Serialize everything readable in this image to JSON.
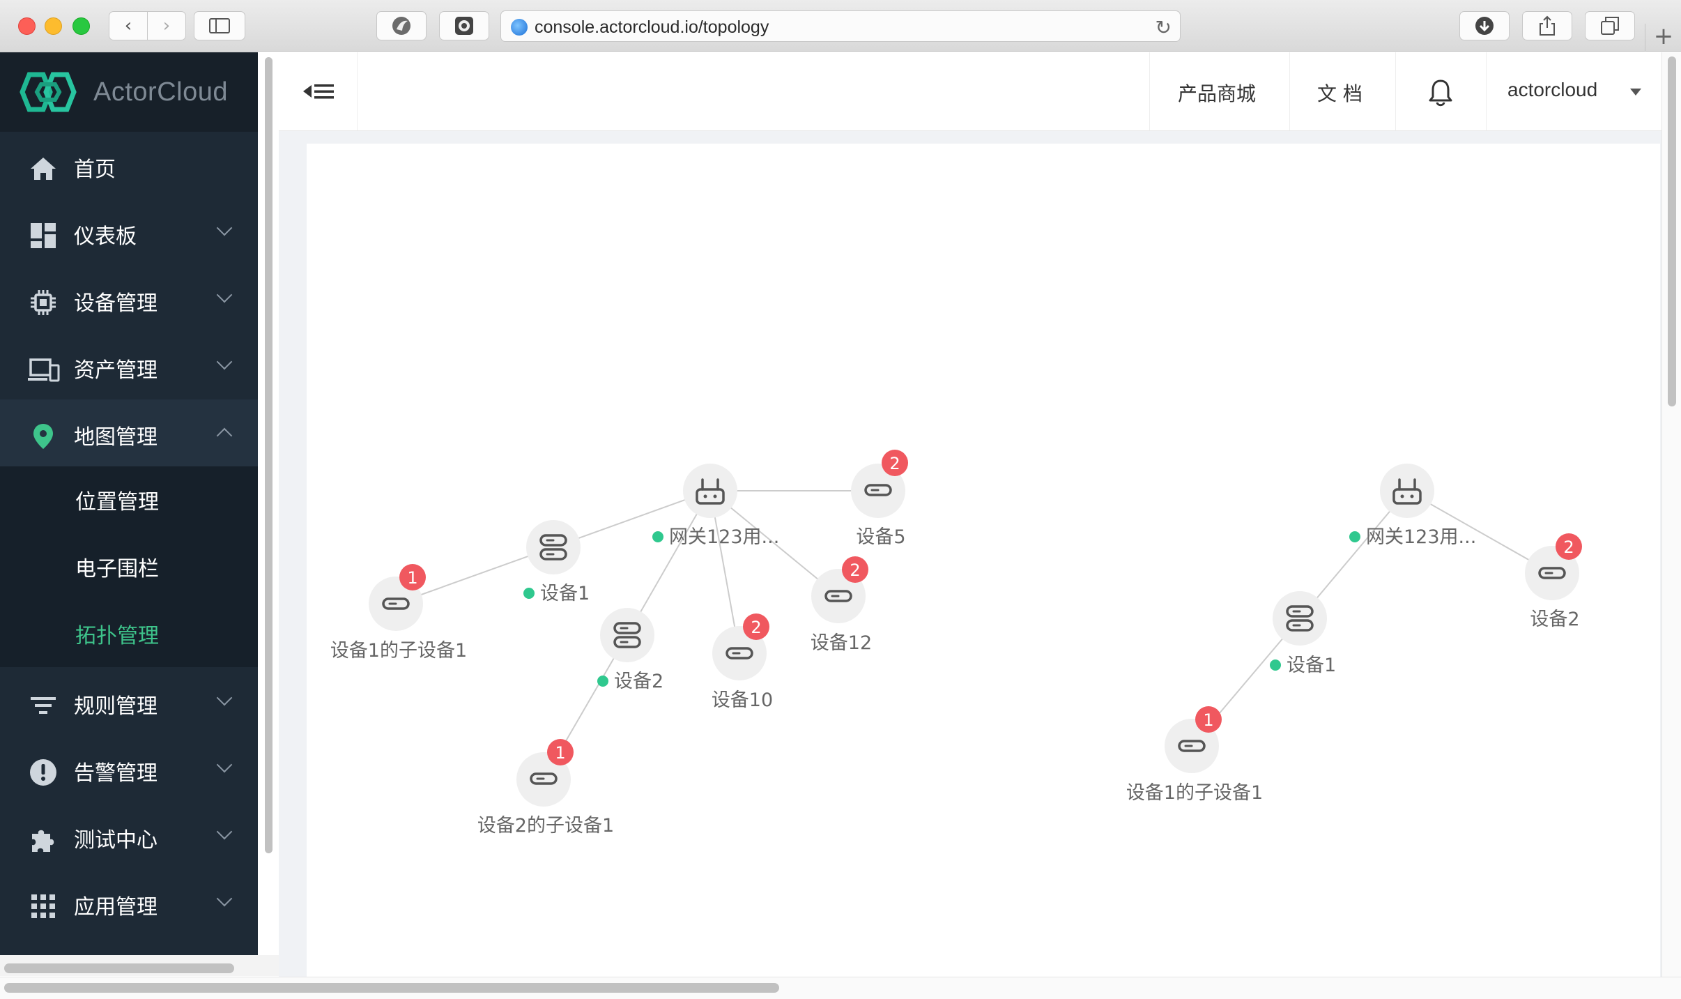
{
  "browser": {
    "url": "console.actorcloud.io/topology"
  },
  "app": {
    "logo_text": "ActorCloud"
  },
  "sidebar": {
    "items": [
      {
        "label": "首页",
        "icon": "home-icon"
      },
      {
        "label": "仪表板",
        "icon": "dashboard-icon"
      },
      {
        "label": "设备管理",
        "icon": "chip-icon"
      },
      {
        "label": "资产管理",
        "icon": "devices-icon"
      },
      {
        "label": "地图管理",
        "icon": "location-pin-icon",
        "expanded": true
      },
      {
        "label": "规则管理",
        "icon": "filter-icon"
      },
      {
        "label": "告警管理",
        "icon": "alert-icon"
      },
      {
        "label": "测试中心",
        "icon": "puzzle-icon"
      },
      {
        "label": "应用管理",
        "icon": "apps-grid-icon"
      }
    ],
    "map_submenu": [
      {
        "label": "位置管理"
      },
      {
        "label": "电子围栏"
      },
      {
        "label": "拓扑管理",
        "active": true
      }
    ],
    "accent_color": "#3ec48b"
  },
  "header": {
    "store": "产品商城",
    "docs": "文 档",
    "user": "actorcloud"
  },
  "topology": {
    "status_online_color": "#2fc88e",
    "badge_color": "#f0585f",
    "graph1": {
      "nodes": [
        {
          "id": "g1",
          "type": "gateway",
          "label": "网关123用...",
          "online": true
        },
        {
          "id": "d5",
          "type": "device",
          "label": "设备5",
          "badge": "2"
        },
        {
          "id": "d1",
          "type": "device-group",
          "label": "设备1",
          "online": true
        },
        {
          "id": "d1c",
          "type": "device",
          "label": "设备1的子设备1",
          "badge": "1"
        },
        {
          "id": "d2",
          "type": "device-group",
          "label": "设备2",
          "online": true
        },
        {
          "id": "d2c",
          "type": "device",
          "label": "设备2的子设备1",
          "badge": "1"
        },
        {
          "id": "d10",
          "type": "device",
          "label": "设备10",
          "badge": "2"
        },
        {
          "id": "d12",
          "type": "device",
          "label": "设备12",
          "badge": "2"
        }
      ]
    },
    "graph2": {
      "nodes": [
        {
          "id": "g2",
          "type": "gateway",
          "label": "网关123用...",
          "online": true
        },
        {
          "id": "e2",
          "type": "device",
          "label": "设备2",
          "badge": "2"
        },
        {
          "id": "e1",
          "type": "device-group",
          "label": "设备1",
          "online": true
        },
        {
          "id": "e1c",
          "type": "device",
          "label": "设备1的子设备1",
          "badge": "1"
        }
      ]
    }
  }
}
